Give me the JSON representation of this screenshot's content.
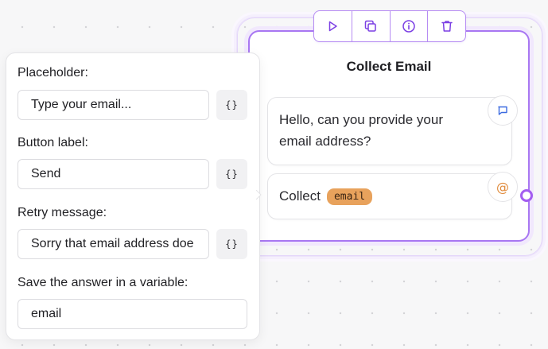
{
  "group": {
    "title": "Collect Email",
    "text_block": {
      "message": "Hello, can you provide your email address?",
      "icon": "chat-bubble-icon"
    },
    "input_block": {
      "prefix": "Collect",
      "variable": "email",
      "icon": "at-sign-icon"
    }
  },
  "toolbar": {
    "buttons": [
      {
        "icon": "play-icon"
      },
      {
        "icon": "duplicate-icon"
      },
      {
        "icon": "info-icon"
      },
      {
        "icon": "trash-icon"
      }
    ]
  },
  "settings": {
    "placeholder_label": "Placeholder:",
    "placeholder_value": "Type your email...",
    "button_label_label": "Button label:",
    "button_label_value": "Send",
    "retry_label": "Retry message:",
    "retry_value": "Sorry that email address doe",
    "save_label": "Save the answer in a variable:",
    "save_value": "email",
    "variable_button": "{}"
  },
  "colors": {
    "accent": "#a35df0",
    "variable_chip": "#e8a25c",
    "canvas": "#f7f7f8"
  }
}
